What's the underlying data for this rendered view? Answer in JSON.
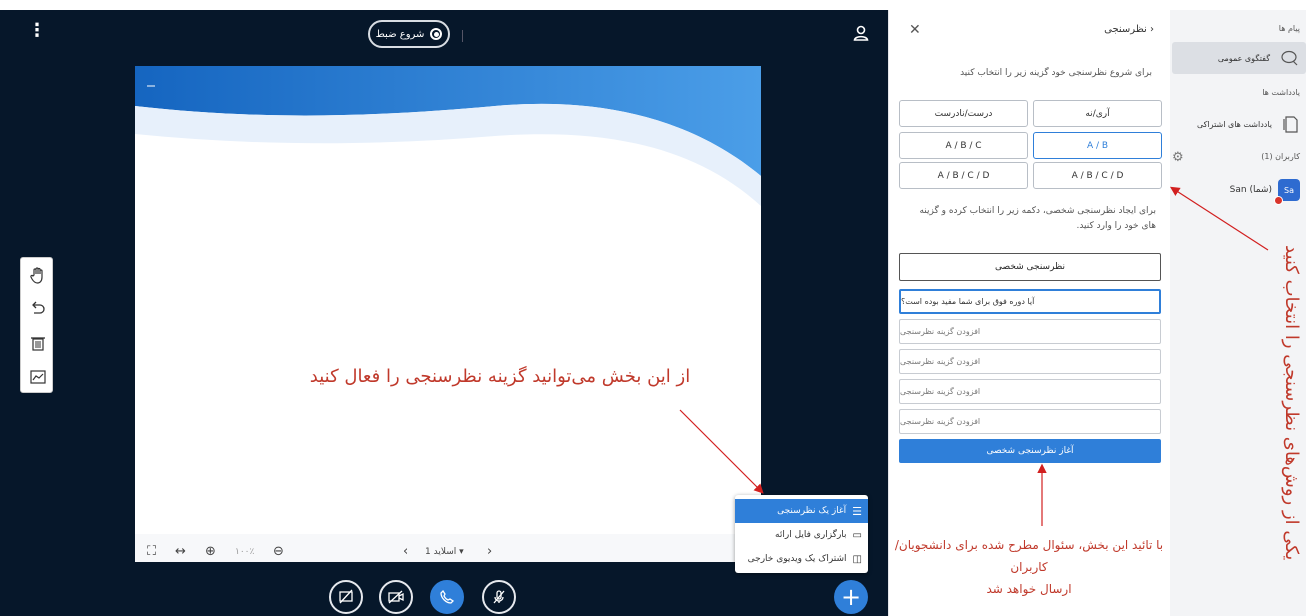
{
  "topbar": {
    "record_label": "شروع ضبط"
  },
  "slide": {
    "annotation": "از این بخش می‌توانید گزینه نظرسنجی را فعال کنید",
    "slide_label": "اسلاید 1",
    "zoom": "۱۰۰٪"
  },
  "plus_menu": {
    "items": [
      {
        "label": "آغاز یک نظرسنجی",
        "icon": "poll-icon"
      },
      {
        "label": "بارگزاری فایل ارائه",
        "icon": "presentation-icon"
      },
      {
        "label": "اشتراک یک ویدیوی خارجی",
        "icon": "video-icon"
      }
    ]
  },
  "poll": {
    "title": "نظرسنجی",
    "instruction": "برای شروع نظرسنجی خود گزینه زیر را انتخاب کنید",
    "options": [
      "آری/نه",
      "درست/نادرست",
      "A / B",
      "A / B / C",
      "A / B / C / D",
      "A / B / C / D"
    ],
    "custom_desc": "برای ایجاد نظرسنجی شخصی، دکمه زیر را انتخاب کرده و گزینه های خود را وارد کنید.",
    "custom_button": "نظرسنجی شخصی",
    "question_value": "آیا دوره فوق برای شما مفید بوده است؟",
    "option_placeholder": "افزودن گزینه نظرسنجی",
    "start_button": "آغاز نظرسنجی شخصی",
    "annotation_line1": "با تائید این بخش، سئوال مطرح شده برای دانشجویان/کاربران",
    "annotation_line2": "ارسال خواهد شد"
  },
  "sidebar": {
    "messages_label": "پیام ها",
    "public_chat": "گفتگوی عمومی",
    "notes_label": "یادداشت ها",
    "shared_notes": "یادداشت های اشتراکی",
    "users_label": "کاربران (1)",
    "user_initials": "Sa",
    "user_name": "San (شما)",
    "annotation": "یکی از روش‌های نظرسنجی را انتخاب کنید"
  },
  "colors": {
    "primary": "#2f7fd9",
    "main_bg": "#06172a",
    "annotation": "#c0392b"
  }
}
